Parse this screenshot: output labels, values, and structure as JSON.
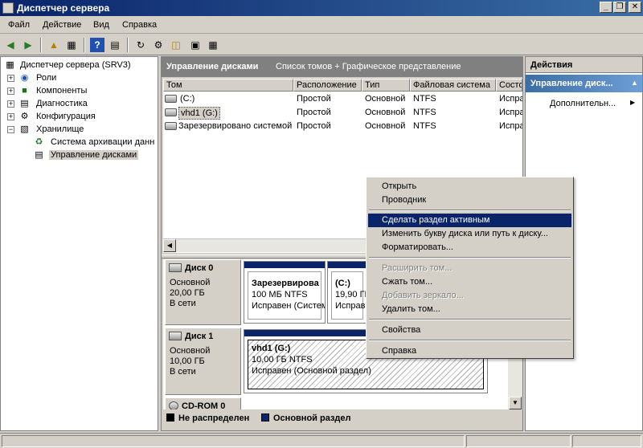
{
  "window": {
    "title": "Диспетчер сервера",
    "buttons": [
      "_",
      "❐",
      "✕"
    ]
  },
  "menu": [
    "Файл",
    "Действие",
    "Вид",
    "Справка"
  ],
  "toolbar": [
    "back-arrow-icon",
    "forward-arrow-icon",
    "up-folder-icon",
    "show-hide-tree-icon",
    "help-icon",
    "show-hide-action-pane-icon",
    "refresh-icon",
    "properties-icon",
    "open-icon",
    "rescan-icon"
  ],
  "tree": {
    "root": "Диспетчер сервера (SRV3)",
    "items": [
      {
        "label": "Роли",
        "expander": "+"
      },
      {
        "label": "Компоненты",
        "expander": "+"
      },
      {
        "label": "Диагностика",
        "expander": "+"
      },
      {
        "label": "Конфигурация",
        "expander": "+"
      },
      {
        "label": "Хранилище",
        "expander": "−"
      }
    ],
    "storage_children": [
      {
        "label": "Система архивации данн"
      },
      {
        "label": "Управление дисками"
      }
    ]
  },
  "center": {
    "title": "Управление дисками",
    "view": "Список томов + Графическое представление",
    "columns": [
      "Том",
      "Расположение",
      "Тип",
      "Файловая система",
      "Состо"
    ],
    "volumes": [
      {
        "name": "(C:)",
        "location": "Простой",
        "type": "Основной",
        "fs": "NTFS",
        "status": "Испра"
      },
      {
        "name": "vhd1 (G:)",
        "location": "Простой",
        "type": "Основной",
        "fs": "NTFS",
        "status": "Испра"
      },
      {
        "name": "Зарезервировано системой",
        "location": "Простой",
        "type": "Основной",
        "fs": "NTFS",
        "status": "Испра"
      }
    ]
  },
  "disks": [
    {
      "name": "Диск 0",
      "type": "Основной",
      "size": "20,00 ГБ",
      "state": "В сети",
      "partitions": [
        {
          "name": "Зарезервирова",
          "size": "100 МБ NTFS",
          "status": "Исправен (Систем"
        },
        {
          "name": "(C:)",
          "size": "19,90 ГБ",
          "status": "Исправ"
        }
      ]
    },
    {
      "name": "Диск 1",
      "type": "Основной",
      "size": "10,00 ГБ",
      "state": "В сети",
      "partitions": [
        {
          "name": "vhd1  (G:)",
          "size": "10,00 ГБ NTFS",
          "status": "Исправен (Основной раздел)"
        }
      ]
    },
    {
      "name": "CD-ROM 0"
    }
  ],
  "legend": [
    {
      "label": "Не распределен",
      "color": "#000000"
    },
    {
      "label": "Основной раздел",
      "color": "#0a246a"
    }
  ],
  "actions": {
    "header": "Действия",
    "section": "Управление диск...",
    "item": "Дополнительн..."
  },
  "context_menu": {
    "open": "Открыть",
    "explorer": "Проводник",
    "mark_active": "Сделать раздел активным",
    "change_letter": "Изменить букву диска или путь к диску...",
    "format": "Форматировать...",
    "extend": "Расширить том...",
    "shrink": "Сжать том...",
    "add_mirror": "Добавить зеркало...",
    "delete": "Удалить том...",
    "properties": "Свойства",
    "help": "Справка"
  },
  "colors": {
    "title_bar": "#0a246a",
    "primary_partition": "#0a246a",
    "selection": "#0a246a",
    "window_bg": "#d4d0c8"
  }
}
